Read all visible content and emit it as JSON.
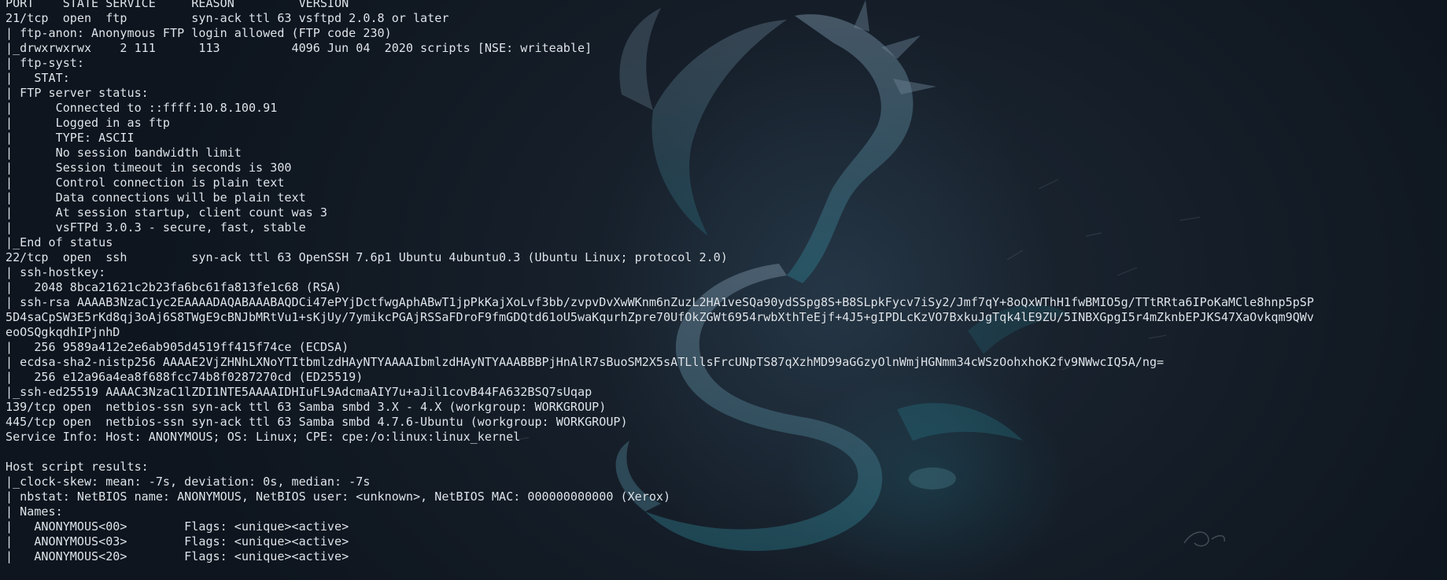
{
  "terminal": {
    "lines": [
      "PORT    STATE SERVICE     REASON         VERSION",
      "21/tcp  open  ftp         syn-ack ttl 63 vsftpd 2.0.8 or later",
      "| ftp-anon: Anonymous FTP login allowed (FTP code 230)",
      "|_drwxrwxrwx    2 111      113          4096 Jun 04  2020 scripts [NSE: writeable]",
      "| ftp-syst: ",
      "|   STAT: ",
      "| FTP server status:",
      "|      Connected to ::ffff:10.8.100.91",
      "|      Logged in as ftp",
      "|      TYPE: ASCII",
      "|      No session bandwidth limit",
      "|      Session timeout in seconds is 300",
      "|      Control connection is plain text",
      "|      Data connections will be plain text",
      "|      At session startup, client count was 3",
      "|      vsFTPd 3.0.3 - secure, fast, stable",
      "|_End of status",
      "22/tcp  open  ssh         syn-ack ttl 63 OpenSSH 7.6p1 Ubuntu 4ubuntu0.3 (Ubuntu Linux; protocol 2.0)",
      "| ssh-hostkey: ",
      "|   2048 8bca21621c2b23fa6bc61fa813fe1c68 (RSA)",
      "| ssh-rsa AAAAB3NzaC1yc2EAAAADAQABAAABAQDCi47ePYjDctfwgAphABwT1jpPkKajXoLvf3bb/zvpvDvXwWKnm6nZuzL2HA1veSQa90ydSSpg8S+B8SLpkFycv7iSy2/Jmf7qY+8oQxWThH1fwBMIO5g/TTtRRta6IPoKaMCle8hnp5pSP",
      "5D4saCpSW3E5rKd8qj3oAj6S8TWgE9cBNJbMRtVu1+sKjUy/7ymikcPGAjRSSaFDroF9fmGDQtd61oU5waKqurhZpre70UfOkZGWt6954rwbXthTeEjf+4J5+gIPDLcKzVO7BxkuJgTqk4lE9ZU/5INBXGpgI5r4mZknbEPJKS47XaOvkqm9QWv",
      "eoOSQgkqdhIPjnhD",
      "|   256 9589a412e2e6ab905d4519ff415f74ce (ECDSA)",
      "| ecdsa-sha2-nistp256 AAAAE2VjZHNhLXNoYTItbmlzdHAyNTYAAAAIbmlzdHAyNTYAAABBBPjHnAlR7sBuoSM2X5sATLllsFrcUNpTS87qXzhMD99aGGzyOlnWmjHGNmm34cWSzOohxhoK2fv9NWwcIQ5A/ng=",
      "|   256 e12a96a4ea8f688fcc74b8f0287270cd (ED25519)",
      "|_ssh-ed25519 AAAAC3NzaC1lZDI1NTE5AAAAIDHIuFL9AdcmaAIY7u+aJil1covB44FA632BSQ7sUqap",
      "139/tcp open  netbios-ssn syn-ack ttl 63 Samba smbd 3.X - 4.X (workgroup: WORKGROUP)",
      "445/tcp open  netbios-ssn syn-ack ttl 63 Samba smbd 4.7.6-Ubuntu (workgroup: WORKGROUP)",
      "Service Info: Host: ANONYMOUS; OS: Linux; CPE: cpe:/o:linux:linux_kernel",
      "",
      "Host script results:",
      "|_clock-skew: mean: -7s, deviation: 0s, median: -7s",
      "| nbstat: NetBIOS name: ANONYMOUS, NetBIOS user: <unknown>, NetBIOS MAC: 000000000000 (Xerox)",
      "| Names:",
      "|   ANONYMOUS<00>        Flags: <unique><active>",
      "|   ANONYMOUS<03>        Flags: <unique><active>",
      "|   ANONYMOUS<20>        Flags: <unique><active>"
    ]
  }
}
